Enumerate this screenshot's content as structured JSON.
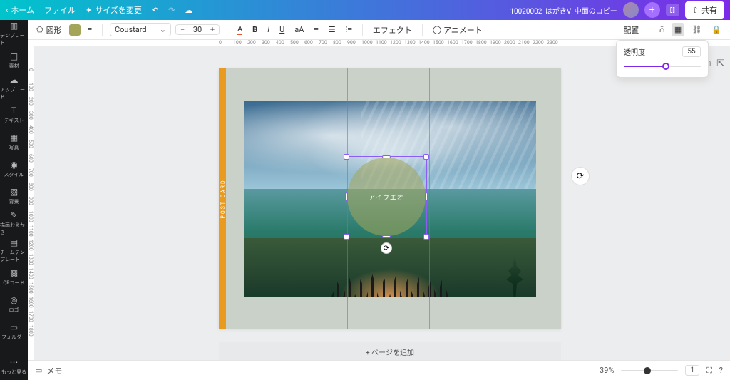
{
  "topbar": {
    "home": "ホーム",
    "file": "ファイル",
    "resize": "サイズを変更",
    "title": "10020002_はがきV_中面のコピー",
    "share": "共有"
  },
  "sidebar": {
    "items": [
      {
        "label": "テンプレート",
        "icon": "template"
      },
      {
        "label": "素材",
        "icon": "shapes"
      },
      {
        "label": "アップロード",
        "icon": "upload"
      },
      {
        "label": "テキスト",
        "icon": "text"
      },
      {
        "label": "写真",
        "icon": "photo"
      },
      {
        "label": "スタイル",
        "icon": "style"
      },
      {
        "label": "背景",
        "icon": "bg"
      },
      {
        "label": "描画おえかき",
        "icon": "draw"
      },
      {
        "label": "チームテンプレート",
        "icon": "team"
      },
      {
        "label": "QRコード",
        "icon": "qr"
      },
      {
        "label": "ロゴ",
        "icon": "logo"
      },
      {
        "label": "フォルダー",
        "icon": "folder"
      }
    ],
    "more": "もっと見る"
  },
  "toolbar": {
    "shape_label": "図形",
    "font": "Coustard",
    "font_size": "30",
    "effects": "エフェクト",
    "animate": "アニメート",
    "position": "配置"
  },
  "popover": {
    "label": "透明度",
    "value": "55"
  },
  "ruler_h": [
    "0",
    "100",
    "200",
    "300",
    "400",
    "500",
    "600",
    "700",
    "800",
    "900",
    "1000",
    "1100",
    "1200",
    "1300",
    "1400",
    "1500",
    "1600",
    "1700",
    "1800",
    "1900",
    "2000",
    "2100",
    "2200",
    "2300"
  ],
  "ruler_v": [
    "0",
    "100",
    "200",
    "300",
    "400",
    "500",
    "600",
    "700",
    "800",
    "900",
    "1000",
    "1100",
    "1200",
    "1300",
    "1400",
    "1500",
    "1600",
    "1700",
    "1800"
  ],
  "canvas": {
    "postcard_label": "POST CARD",
    "circle_text": "アイウエオ",
    "add_page": "+ ページを追加"
  },
  "bottombar": {
    "notes": "メモ",
    "zoom": "39%",
    "page_count": "1"
  }
}
